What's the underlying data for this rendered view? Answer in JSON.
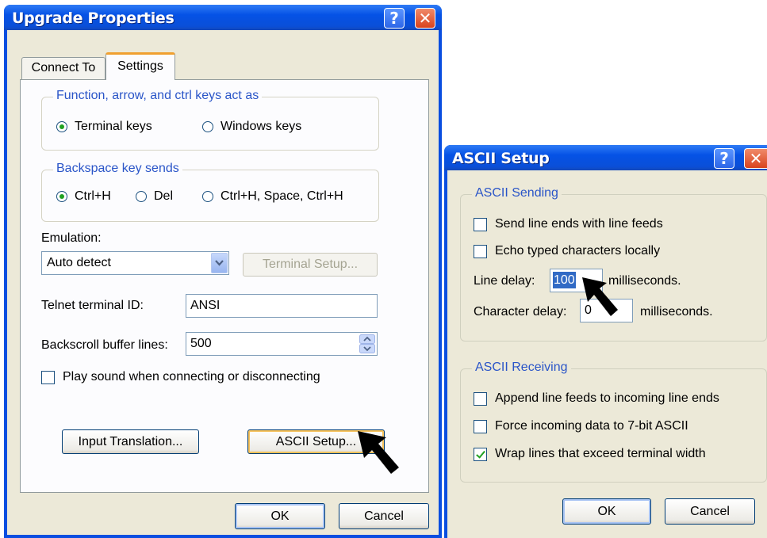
{
  "upgrade": {
    "title": "Upgrade Properties",
    "help_label": "?",
    "close_label": "✕",
    "tabs": [
      {
        "label": "Connect To",
        "active": false
      },
      {
        "label": "Settings",
        "active": true
      }
    ],
    "keys_group": {
      "title": "Function, arrow, and ctrl keys act as",
      "options": [
        {
          "label": "Terminal keys",
          "checked": true
        },
        {
          "label": "Windows keys",
          "checked": false
        }
      ]
    },
    "backspace_group": {
      "title": "Backspace key sends",
      "options": [
        {
          "label": "Ctrl+H",
          "checked": true
        },
        {
          "label": "Del",
          "checked": false
        },
        {
          "label": "Ctrl+H, Space, Ctrl+H",
          "checked": false
        }
      ]
    },
    "emulation": {
      "label": "Emulation:",
      "value": "Auto detect",
      "terminal_setup_label": "Terminal Setup..."
    },
    "telnet_id": {
      "label": "Telnet terminal ID:",
      "value": "ANSI"
    },
    "backscroll": {
      "label": "Backscroll buffer lines:",
      "value": "500"
    },
    "play_sound": {
      "label": "Play sound when connecting or disconnecting",
      "checked": false
    },
    "input_translation_label": "Input Translation...",
    "ascii_setup_label": "ASCII Setup...",
    "ok_label": "OK",
    "cancel_label": "Cancel"
  },
  "ascii": {
    "title": "ASCII Setup",
    "help_label": "?",
    "close_label": "✕",
    "sending": {
      "title": "ASCII Sending",
      "send_line_ends": {
        "label": "Send line ends with line feeds",
        "checked": false
      },
      "echo_typed": {
        "label": "Echo typed characters locally",
        "checked": false
      },
      "line_delay": {
        "label": "Line delay:",
        "value": "100",
        "unit": "milliseconds."
      },
      "char_delay": {
        "label": "Character delay:",
        "value": "0",
        "unit": "milliseconds."
      }
    },
    "receiving": {
      "title": "ASCII Receiving",
      "append_lf": {
        "label": "Append line feeds to incoming line ends",
        "checked": false
      },
      "force_7bit": {
        "label": "Force incoming data to 7-bit ASCII",
        "checked": false
      },
      "wrap_lines": {
        "label": "Wrap lines that exceed terminal width",
        "checked": true
      }
    },
    "ok_label": "OK",
    "cancel_label": "Cancel"
  },
  "colors": {
    "titlebar": "#0552e6",
    "dialog_face": "#ece9d8",
    "group_title": "#2a55c8",
    "check_mark": "#21a121"
  }
}
